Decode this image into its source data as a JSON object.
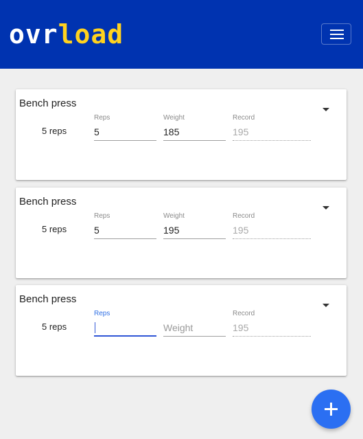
{
  "header": {
    "logo_part1": "ovr",
    "logo_part2": "load",
    "menu_icon": "hamburger-menu-icon"
  },
  "cards": [
    {
      "title": "Bench press",
      "sets_label": "5 reps",
      "reps": {
        "label": "Reps",
        "value": "5"
      },
      "weight": {
        "label": "Weight",
        "value": "185"
      },
      "record": {
        "label": "Record",
        "value": "195"
      }
    },
    {
      "title": "Bench press",
      "sets_label": "5 reps",
      "reps": {
        "label": "Reps",
        "value": "5"
      },
      "weight": {
        "label": "Weight",
        "value": "195"
      },
      "record": {
        "label": "Record",
        "value": "195"
      }
    },
    {
      "title": "Bench press",
      "sets_label": "5 reps",
      "reps": {
        "label": "Reps",
        "value": ""
      },
      "weight": {
        "label": "",
        "placeholder": "Weight",
        "value": ""
      },
      "record": {
        "label": "Record",
        "value": "195"
      }
    }
  ],
  "fab": {
    "icon": "plus-icon"
  },
  "colors": {
    "appbar": "#0033b0",
    "logo_accent": "#ffd21f",
    "accent": "#2b6ff2"
  }
}
